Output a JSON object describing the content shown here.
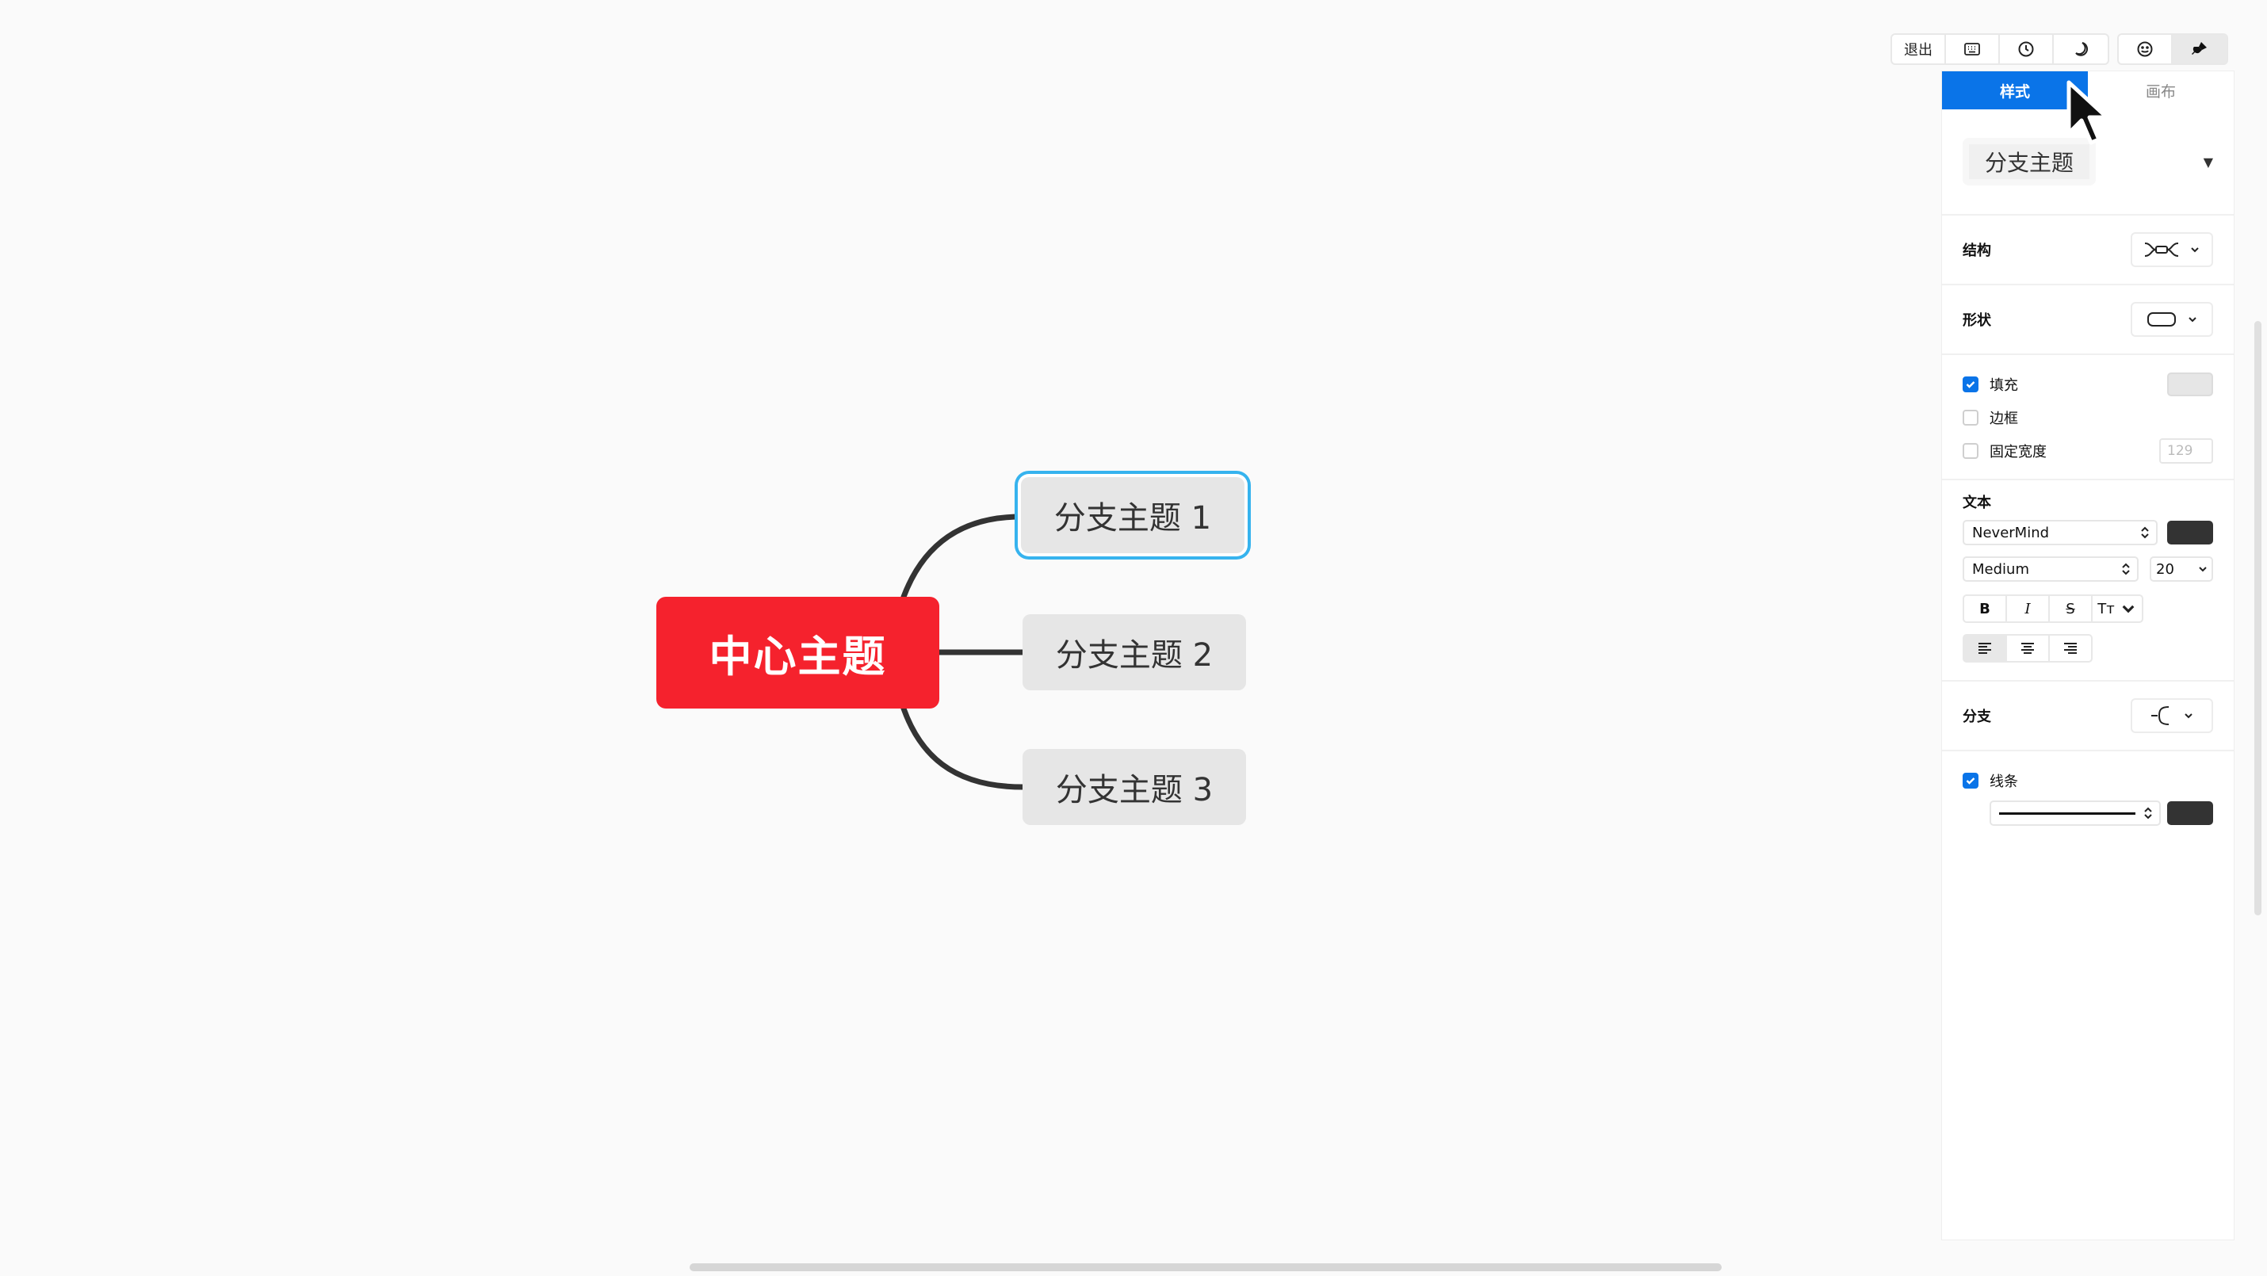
{
  "canvas": {
    "central_topic": "中心主题",
    "branches": [
      "分支主题 1",
      "分支主题 2",
      "分支主题 3"
    ],
    "central_color": "#f5222d",
    "branch_color": "#e6e6e6",
    "selection_color": "#36b3ee",
    "line_color": "#333333"
  },
  "toolbar": {
    "exit_label": "退出",
    "icons": [
      "keyboard-icon",
      "clock-icon",
      "moon-icon",
      "emoji-icon",
      "brush-icon"
    ]
  },
  "panel": {
    "tabs": {
      "style": "样式",
      "canvas": "画布"
    },
    "preset": "分支主题",
    "structure_label": "结构",
    "shape_label": "形状",
    "fill_label": "填充",
    "fill_checked": true,
    "fill_color": "#e6e6e6",
    "border_label": "边框",
    "border_checked": false,
    "fixed_width_label": "固定宽度",
    "fixed_width_checked": false,
    "fixed_width_value": "129",
    "text_label": "文本",
    "font_family": "NeverMind",
    "font_weight": "Medium",
    "font_size": "20",
    "text_color": "#333333",
    "bold": "B",
    "italic": "I",
    "strike": "S",
    "case": "Tт",
    "branch_label": "分支",
    "line_label": "线条",
    "line_checked": true,
    "line_color": "#333333",
    "accent": "#0a74e8"
  }
}
